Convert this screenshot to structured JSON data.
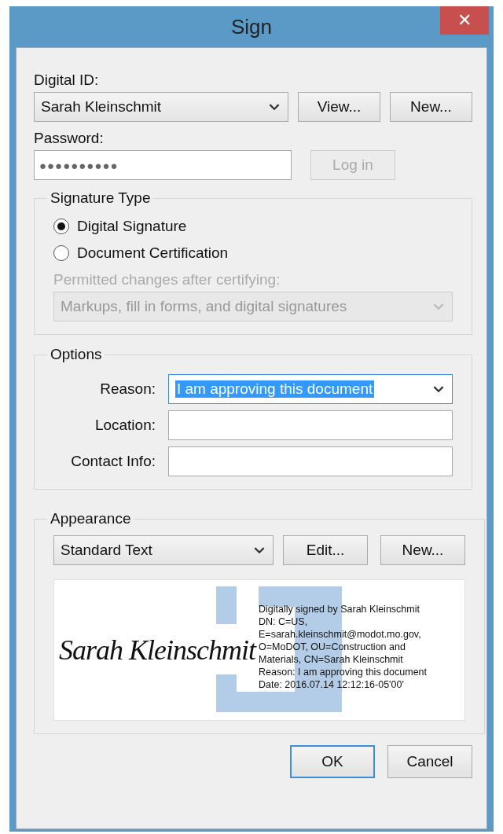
{
  "window": {
    "title": "Sign",
    "close": "✕"
  },
  "digital_id": {
    "label": "Digital ID:",
    "value": "Sarah Kleinschmit",
    "buttons": [
      {
        "label": "View..."
      },
      {
        "label": "New..."
      }
    ]
  },
  "password": {
    "label": "Password:",
    "value": "●●●●●●●●●●",
    "login": {
      "label": "Log in",
      "disabled": true
    }
  },
  "signature_type": {
    "title": "Signature Type",
    "options": [
      {
        "label": "Digital Signature",
        "selected": true
      },
      {
        "label": "Document Certification",
        "selected": false
      }
    ],
    "permitted_label": "Permitted changes after certifying:",
    "permitted_value": "Markups, fill in forms, and digital signatures",
    "disabled": true
  },
  "options": {
    "title": "Options",
    "fields": [
      {
        "label": "Reason:",
        "value": "I am approving this document",
        "kind": "dropdown"
      },
      {
        "label": "Location:",
        "kind": "text"
      },
      {
        "label": "Contact Info:",
        "kind": "text"
      }
    ]
  },
  "appearance": {
    "title": "Appearance",
    "value": "Standard Text",
    "buttons": [
      {
        "label": "Edit..."
      },
      {
        "label": "New..."
      }
    ],
    "preview": {
      "signature": "Sarah Kleinschmit",
      "lines": [
        "Digitally signed by Sarah Kleinschmit",
        "DN: C=US,",
        "E=sarah.kleinschmit@modot.mo.gov,",
        "O=MoDOT, OU=Construction and",
        "Materials, CN=Sarah Kleinschmit",
        "Reason: I am approving this document",
        "Date: 2016.07.14 12:12:16-05'00'"
      ]
    }
  },
  "footer_buttons": [
    {
      "label": "OK",
      "kind": "default"
    },
    {
      "label": "Cancel",
      "kind": "normal"
    }
  ]
}
